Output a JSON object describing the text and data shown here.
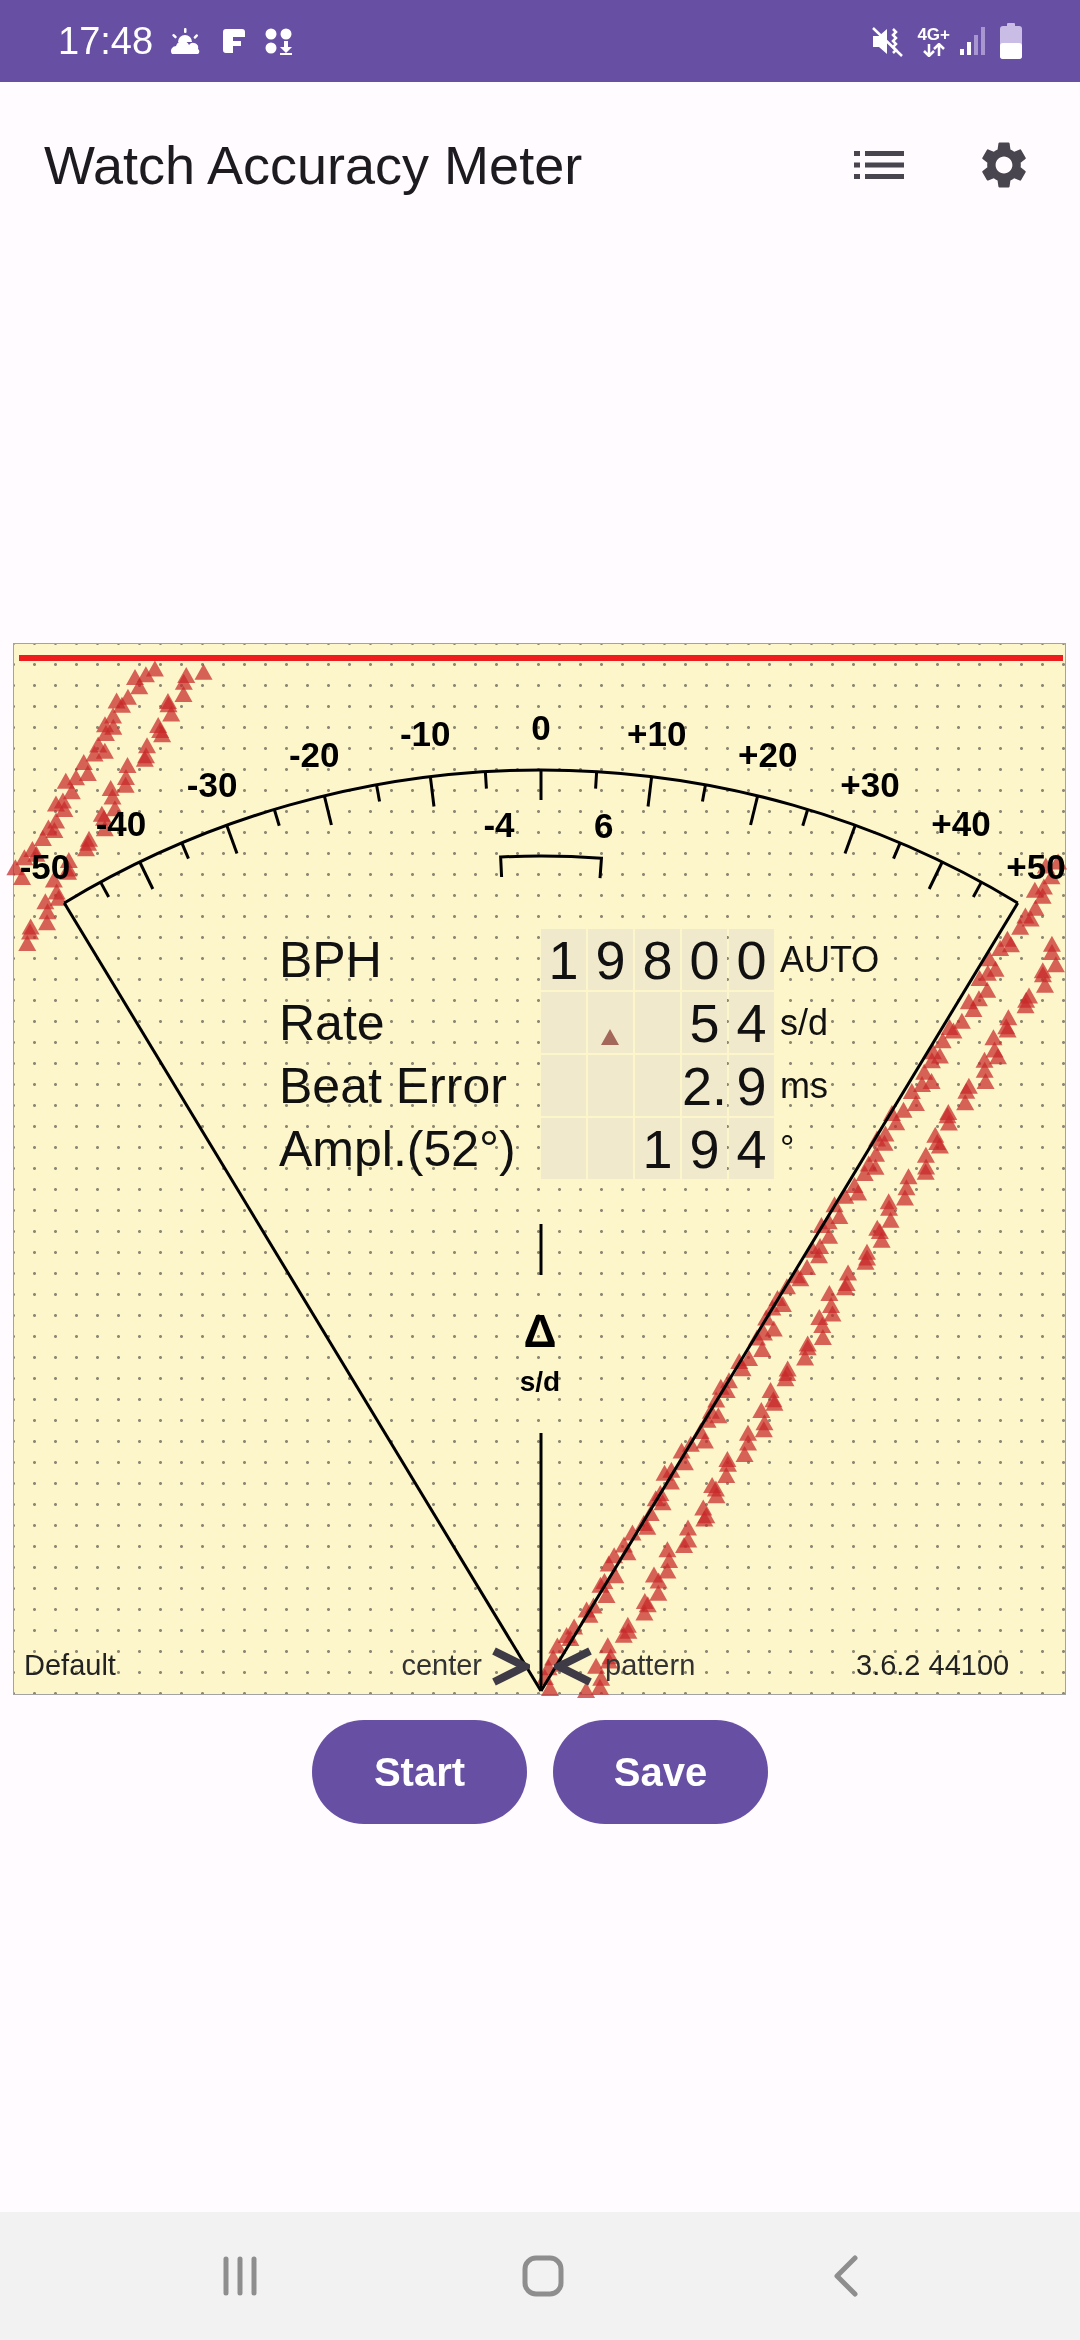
{
  "status_bar": {
    "time": "17:48",
    "network": "4G+"
  },
  "app_bar": {
    "title": "Watch Accuracy Meter"
  },
  "meter": {
    "scale_labels": [
      "-50",
      "-40",
      "-30",
      "-20",
      "-10",
      "0",
      "+10",
      "+20",
      "+30",
      "+40",
      "+50"
    ],
    "tolerance_labels": [
      "-4",
      "6"
    ],
    "readings": [
      {
        "label": "BPH",
        "digits": [
          "1",
          "9",
          "8",
          "0",
          "0"
        ],
        "unit": "AUTO",
        "marker": false
      },
      {
        "label": "Rate",
        "digits": [
          "5",
          "4"
        ],
        "unit": "s/d",
        "marker": true
      },
      {
        "label": "Beat Error",
        "digits": [
          "2.",
          "9"
        ],
        "unit": "ms",
        "marker": false
      },
      {
        "label": "Ampl.(52°)",
        "digits": [
          "1",
          "9",
          "4"
        ],
        "unit": "°",
        "marker": false
      }
    ],
    "axis_symbol": "Δ",
    "axis_unit": "s/d",
    "footer": {
      "profile": "Default",
      "left_hint": "center",
      "right_hint": "pattern",
      "version": "3.6.2 44100"
    }
  },
  "buttons": [
    {
      "label": "Start"
    },
    {
      "label": "Save"
    }
  ]
}
